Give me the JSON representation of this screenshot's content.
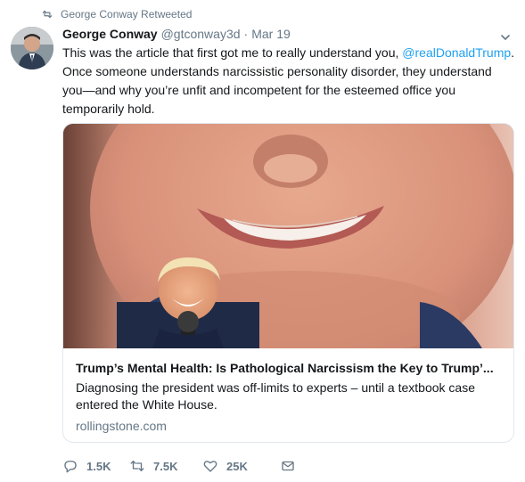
{
  "retweet_context": {
    "text": "George Conway Retweeted"
  },
  "author": {
    "name": "George Conway",
    "handle": "@gtconway3d",
    "date": "Mar 19"
  },
  "tweet": {
    "text_part1": "This was the article that first got me to really understand you, ",
    "mention": "@realDonaldTrump",
    "text_part2": ". Once someone understands narcissistic personality disorder, they understand you—and why you’re unfit and incompetent for the esteemed office you temporarily hold."
  },
  "card": {
    "title": "Trump’s Mental Health: Is Pathological Narcissism the Key to Trump’...",
    "description": "Diagnosing the president was off-limits to experts – until a textbook case entered the White House.",
    "domain": "rollingstone.com"
  },
  "actions": {
    "replies": "1.5K",
    "retweets": "7.5K",
    "likes": "25K"
  },
  "icons": {
    "retweet_context": "retweet-icon",
    "caret": "chevron-down-icon",
    "reply": "reply-icon",
    "retweet": "retweet-icon",
    "like": "heart-icon",
    "dm": "mail-icon"
  },
  "colors": {
    "link": "#1da1f2",
    "secondary_text": "#657786",
    "border": "#e1e8ed"
  }
}
